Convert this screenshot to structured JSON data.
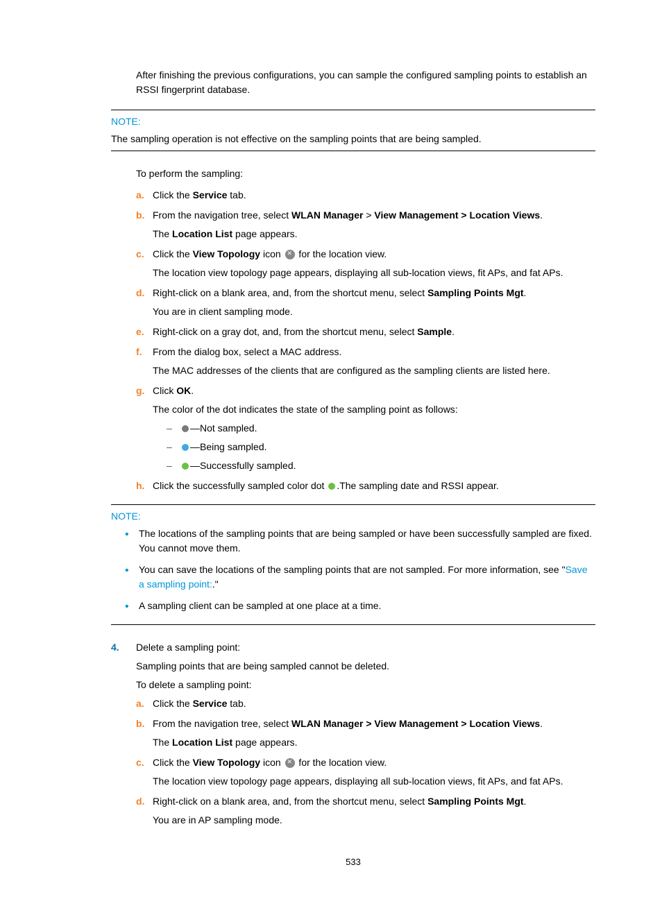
{
  "intro": "After finishing the previous configurations, you can sample the configured sampling points to establish an RSSI fingerprint database.",
  "note1": {
    "label": "NOTE:",
    "text": "The sampling operation is not effective on the sampling points that are being sampled."
  },
  "perform_intro": "To perform the sampling:",
  "steps1": {
    "a": {
      "prefix": "Click the ",
      "b1": "Service",
      "suffix": " tab."
    },
    "b": {
      "prefix": "From the navigation tree, select ",
      "b1": "WLAN Manager",
      "gt": " > ",
      "b2": "View Management > Location Views",
      "suffix": ".",
      "sub": {
        "p1": "The ",
        "b1": "Location List",
        "p2": " page appears."
      }
    },
    "c": {
      "prefix": "Click the ",
      "b1": "View Topology",
      "mid": " icon ",
      "suffix": " for the location view.",
      "sub": "The location view topology page appears, displaying all sub-location views, fit APs, and fat APs."
    },
    "d": {
      "prefix": "Right-click on a blank area, and, from the shortcut menu, select ",
      "b1": "Sampling Points Mgt",
      "suffix": ".",
      "sub": "You are in client sampling mode."
    },
    "e": {
      "prefix": "Right-click on a gray dot, and, from the shortcut menu, select ",
      "b1": "Sample",
      "suffix": "."
    },
    "f": {
      "text": "From the dialog box, select a MAC address.",
      "sub": "The MAC addresses of the clients that are configured as the sampling clients are listed here."
    },
    "g": {
      "prefix": "Click ",
      "b1": "OK",
      "suffix": ".",
      "sub": "The color of the dot indicates the state of the sampling point as follows:",
      "states": {
        "s1": "—Not sampled.",
        "s2": "—Being sampled.",
        "s3": "—Successfully sampled."
      }
    },
    "h": {
      "prefix": "Click the successfully sampled color dot ",
      "suffix": ".The sampling date and RSSI appear."
    }
  },
  "note2": {
    "label": "NOTE:",
    "items": {
      "i1": "The locations of the sampling points that are being sampled or have been successfully sampled are fixed. You cannot move them.",
      "i2": {
        "p1": "You can save the locations of the sampling points that are not sampled. For more information, see \"",
        "link": "Save a sampling point:",
        "p2": ".\""
      },
      "i3": "A sampling client can be sampled at one place at a time."
    }
  },
  "section4": {
    "marker": "4.",
    "title": "Delete a sampling point:",
    "sub1": "Sampling points that are being sampled cannot be deleted.",
    "sub2": "To delete a sampling point:",
    "steps": {
      "a": {
        "prefix": "Click the ",
        "b1": "Service",
        "suffix": " tab."
      },
      "b": {
        "prefix": "From the navigation tree, select ",
        "b1": "WLAN Manager > View Management > Location Views",
        "suffix": ".",
        "sub": {
          "p1": "The ",
          "b1": "Location List",
          "p2": " page appears."
        }
      },
      "c": {
        "prefix": "Click the ",
        "b1": "View Topology",
        "mid": " icon ",
        "suffix": " for the location view.",
        "sub": "The location view topology page appears, displaying all sub-location views, fit APs, and fat APs."
      },
      "d": {
        "prefix": "Right-click on a blank area, and, from the shortcut menu, select ",
        "b1": "Sampling Points Mgt",
        "suffix": ".",
        "sub": "You are in AP sampling mode."
      }
    }
  },
  "page": "533"
}
